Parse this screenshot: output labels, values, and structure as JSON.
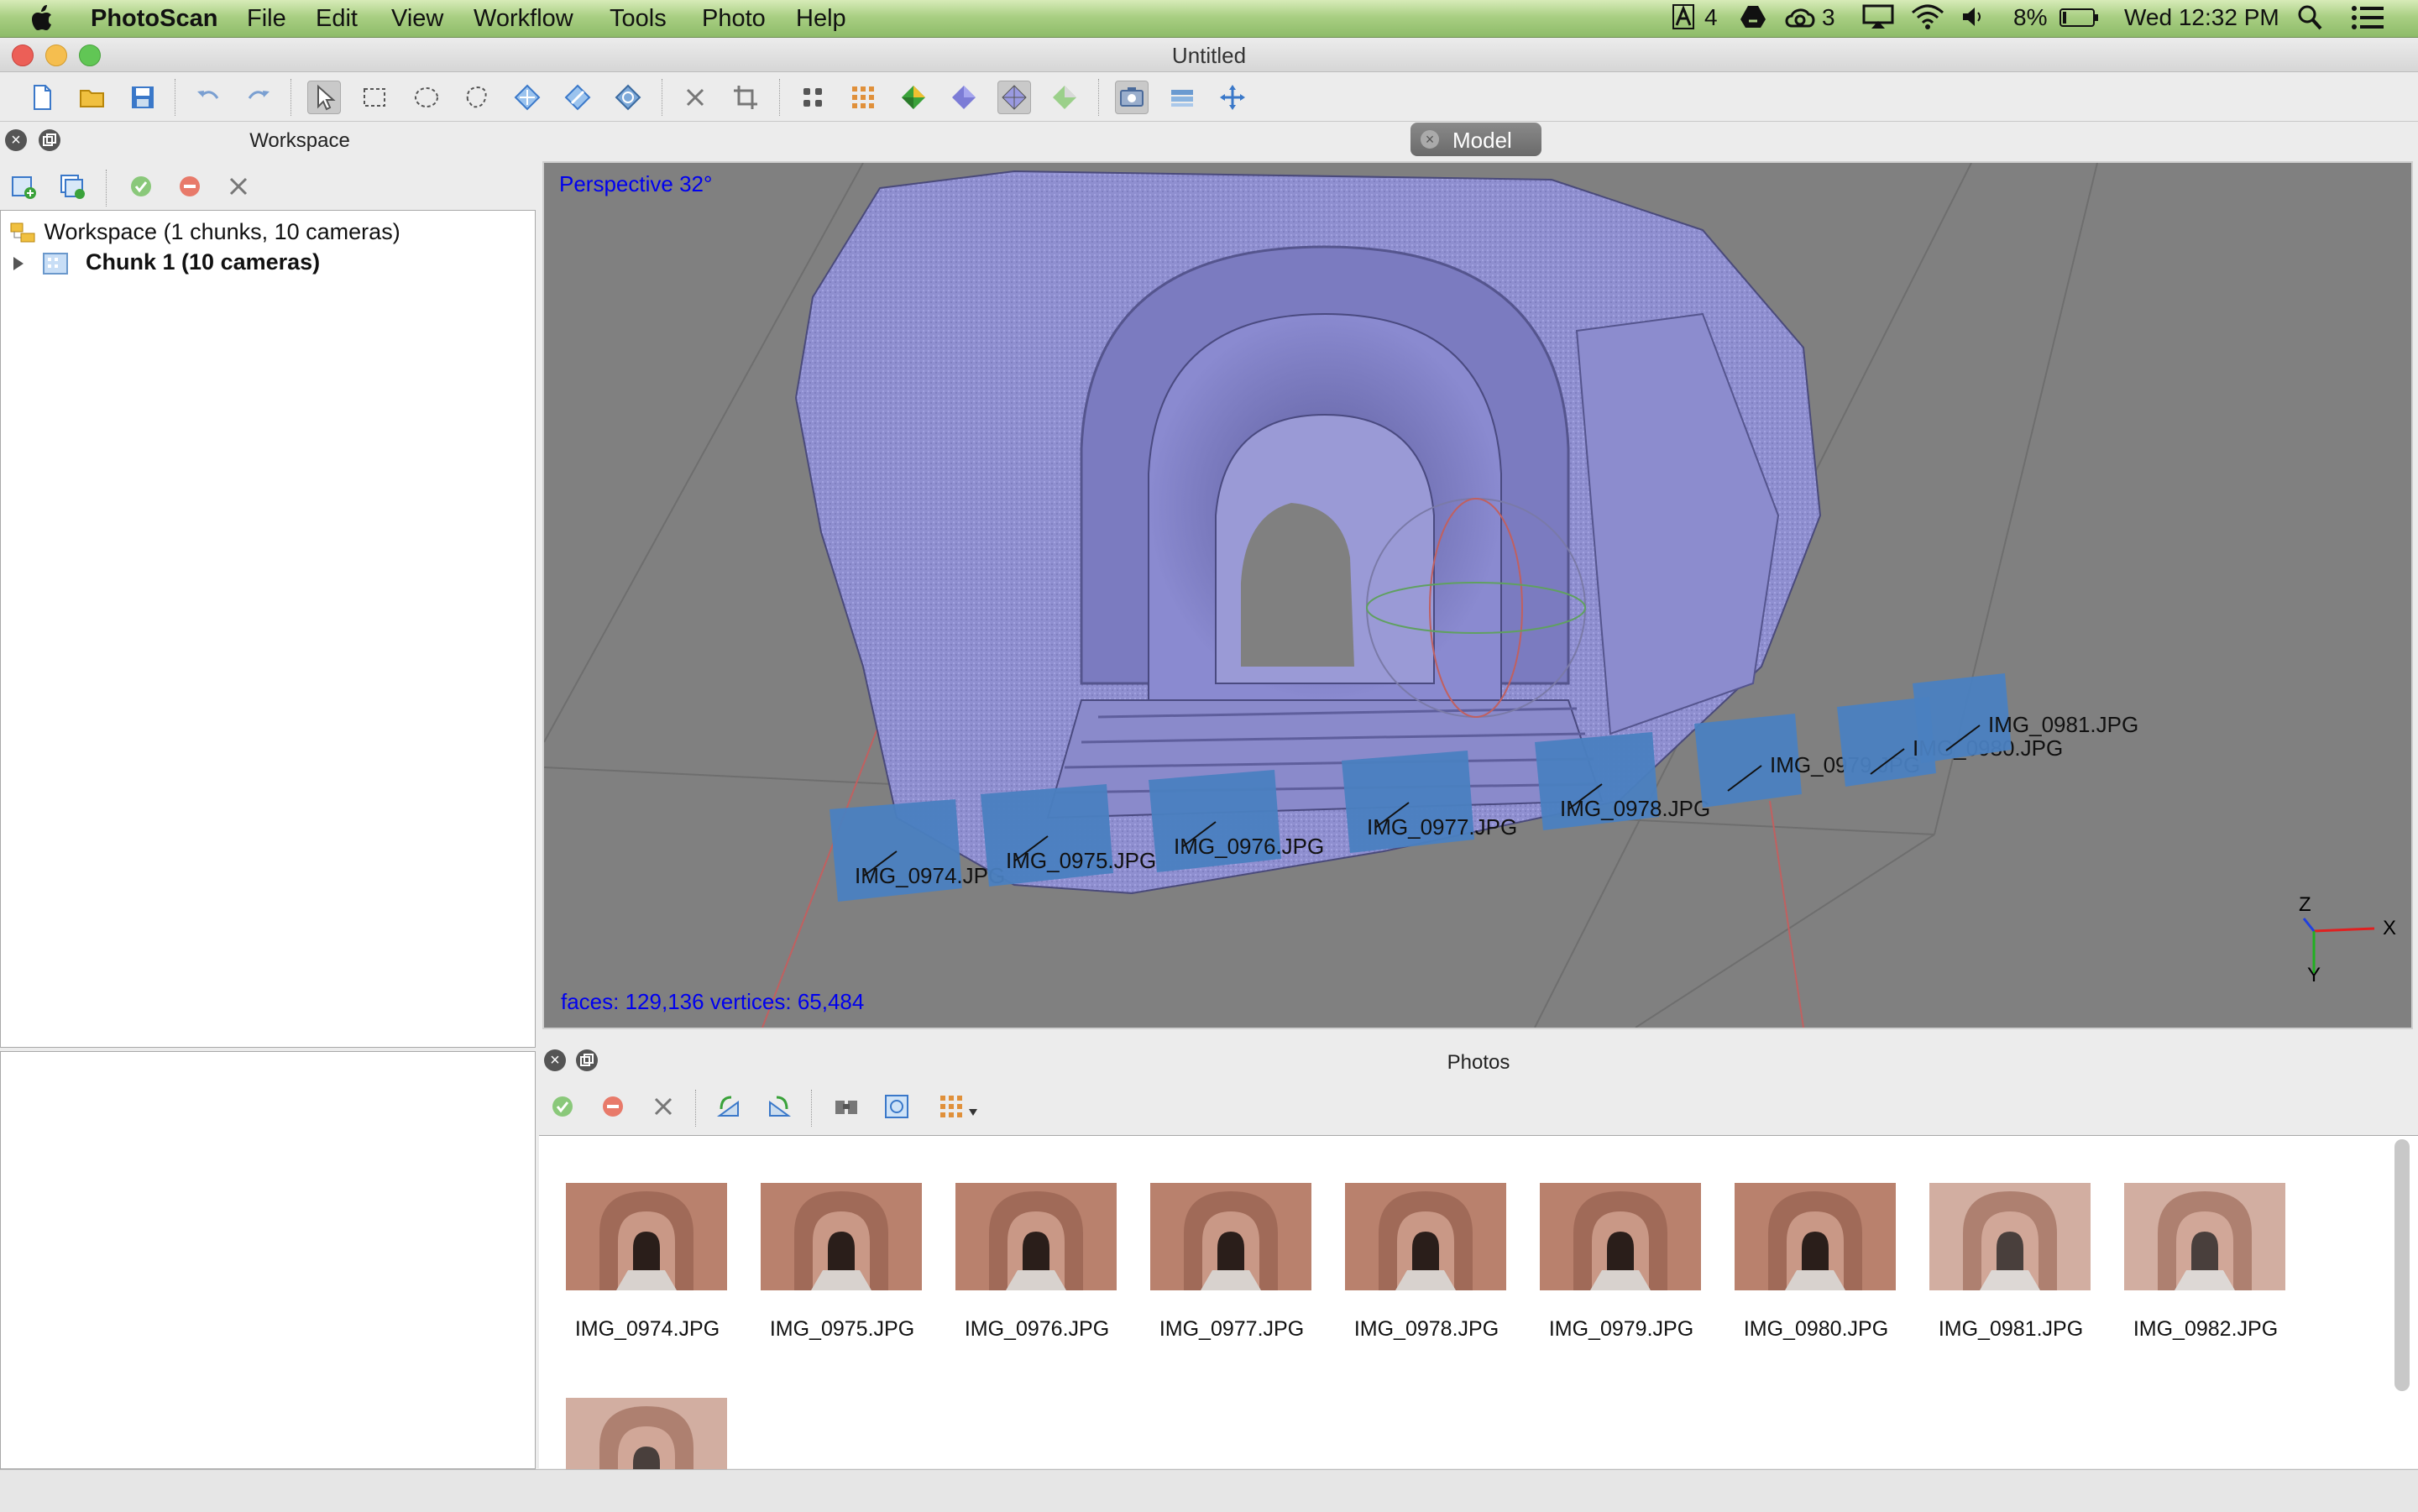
{
  "menubar": {
    "app_name": "PhotoScan",
    "menus": [
      "File",
      "Edit",
      "View",
      "Workflow",
      "Tools",
      "Photo",
      "Help"
    ],
    "status": {
      "adobe_count": "4",
      "cc_count": "3",
      "battery": "8%",
      "clock": "Wed 12:32 PM"
    }
  },
  "window": {
    "title": "Untitled"
  },
  "workspace": {
    "title": "Workspace",
    "root_label": "Workspace (1 chunks, 10 cameras)",
    "chunk_label": "Chunk 1 (10 cameras)"
  },
  "model": {
    "tab_label": "Model",
    "projection": "Perspective 32°",
    "stats": "faces: 129,136 vertices: 65,484",
    "axes": {
      "x": "X",
      "y": "Y",
      "z": "Z"
    },
    "camera_labels": [
      "IMG_0974.JPG",
      "IMG_0975.JPG",
      "IMG_0976.JPG",
      "IMG_0977.JPG",
      "IMG_0978.JPG",
      "IMG_0979.JPG",
      "IMG_0980.JPG",
      "IMG_0981.JPG"
    ]
  },
  "photos": {
    "title": "Photos",
    "items": [
      "IMG_0974.JPG",
      "IMG_0975.JPG",
      "IMG_0976.JPG",
      "IMG_0977.JPG",
      "IMG_0978.JPG",
      "IMG_0979.JPG",
      "IMG_0980.JPG",
      "IMG_0981.JPG",
      "IMG_0982.JPG",
      ""
    ]
  },
  "colors": {
    "mesh": "#8f8fd0",
    "camera": "#4a7fc0",
    "overlay_text": "#0000ee",
    "viewport_bg": "#808080"
  }
}
